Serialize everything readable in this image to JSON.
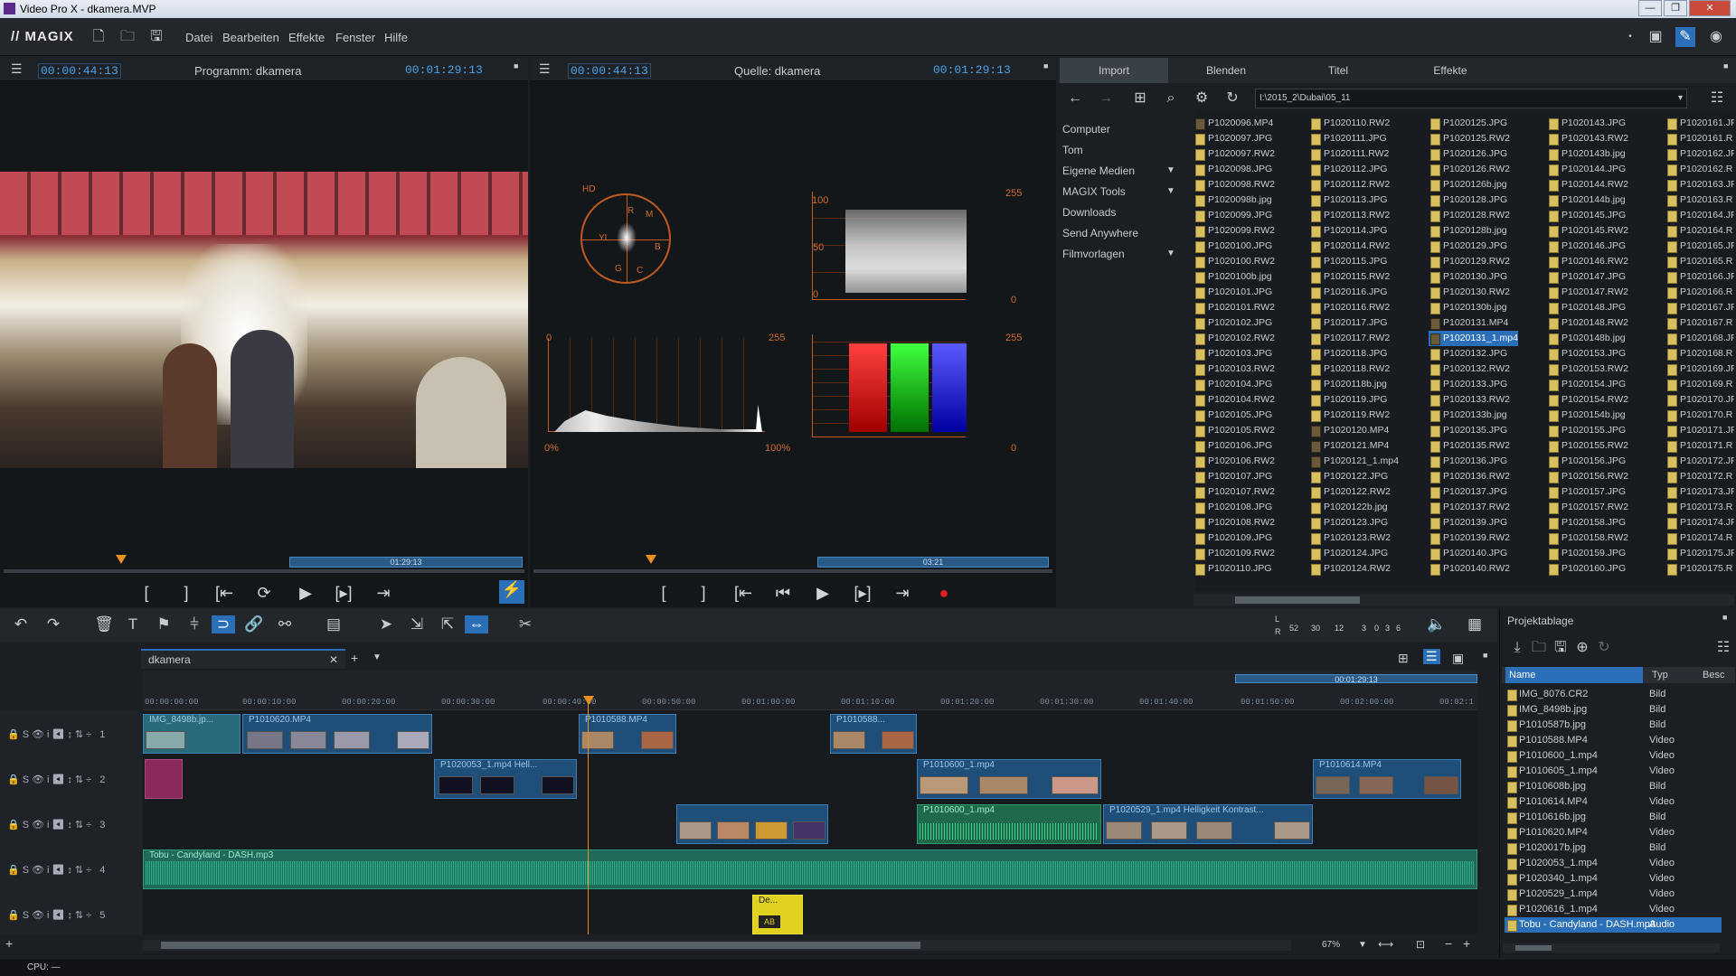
{
  "window": {
    "title": "Video Pro X - dkamera.MVP",
    "min": "—",
    "max": "❐",
    "close": "✕"
  },
  "menu": {
    "logo": "// MAGIX",
    "items": [
      "Datei",
      "Bearbeiten",
      "Effekte",
      "Fenster",
      "Hilfe"
    ]
  },
  "program_monitor": {
    "timecode_left": "00:00:44:13",
    "title": "Programm: dkamera",
    "timecode_right": "00:01:29:13",
    "seek_label": "01:29:13"
  },
  "source_monitor": {
    "timecode_left": "00:00:44:13",
    "title": "Quelle: dkamera",
    "timecode_right": "00:01:29:13",
    "seek_label": "03:21"
  },
  "scopes": {
    "vector_hd": "HD",
    "vector_labels": [
      "R",
      "M",
      "B",
      "C",
      "G",
      "YL"
    ],
    "wave_labels": [
      "100",
      "50",
      "0",
      "255",
      "0"
    ],
    "hist_labels": [
      "0",
      "255",
      "0%",
      "100%"
    ],
    "rgb_labels": [
      "255",
      "0"
    ]
  },
  "import_panel": {
    "tabs": [
      "Import",
      "Blenden",
      "Titel",
      "Effekte"
    ],
    "path": "I:\\2015_2\\Dubai\\05_11",
    "nav": [
      "Computer",
      "Tom",
      "Eigene Medien",
      "MAGIX Tools",
      "Downloads",
      "Send Anywhere",
      "Filmvorlagen"
    ],
    "col1": [
      "P1020096.MP4",
      "P1020097.JPG",
      "P1020097.RW2",
      "P1020098.JPG",
      "P1020098.RW2",
      "P1020098b.jpg",
      "P1020099.JPG",
      "P1020099.RW2",
      "P1020100.JPG",
      "P1020100.RW2",
      "P1020100b.jpg",
      "P1020101.JPG",
      "P1020101.RW2",
      "P1020102.JPG",
      "P1020102.RW2",
      "P1020103.JPG",
      "P1020103.RW2",
      "P1020104.JPG",
      "P1020104.RW2",
      "P1020105.JPG",
      "P1020105.RW2",
      "P1020106.JPG",
      "P1020106.RW2",
      "P1020107.JPG",
      "P1020107.RW2",
      "P1020108.JPG",
      "P1020108.RW2",
      "P1020109.JPG",
      "P1020109.RW2",
      "P1020110.JPG"
    ],
    "col2": [
      "P1020110.RW2",
      "P1020111.JPG",
      "P1020111.RW2",
      "P1020112.JPG",
      "P1020112.RW2",
      "P1020113.JPG",
      "P1020113.RW2",
      "P1020114.JPG",
      "P1020114.RW2",
      "P1020115.JPG",
      "P1020115.RW2",
      "P1020116.JPG",
      "P1020116.RW2",
      "P1020117.JPG",
      "P1020117.RW2",
      "P1020118.JPG",
      "P1020118.RW2",
      "P1020118b.jpg",
      "P1020119.JPG",
      "P1020119.RW2",
      "P1020120.MP4",
      "P1020121.MP4",
      "P1020121_1.mp4",
      "P1020122.JPG",
      "P1020122.RW2",
      "P1020122b.jpg",
      "P1020123.JPG",
      "P1020123.RW2",
      "P1020124.JPG",
      "P1020124.RW2"
    ],
    "col3": [
      "P1020125.JPG",
      "P1020125.RW2",
      "P1020126.JPG",
      "P1020126.RW2",
      "P1020126b.jpg",
      "P1020128.JPG",
      "P1020128.RW2",
      "P1020128b.jpg",
      "P1020129.JPG",
      "P1020129.RW2",
      "P1020130.JPG",
      "P1020130.RW2",
      "P1020130b.jpg",
      "P1020131.MP4",
      "P1020131_1.mp4",
      "P1020132.JPG",
      "P1020132.RW2",
      "P1020133.JPG",
      "P1020133.RW2",
      "P1020133b.jpg",
      "P1020135.JPG",
      "P1020135.RW2",
      "P1020136.JPG",
      "P1020136.RW2",
      "P1020137.JPG",
      "P1020137.RW2",
      "P1020139.JPG",
      "P1020139.RW2",
      "P1020140.JPG",
      "P1020140.RW2"
    ],
    "col4": [
      "P1020143.JPG",
      "P1020143.RW2",
      "P1020143b.jpg",
      "P1020144.JPG",
      "P1020144.RW2",
      "P1020144b.jpg",
      "P1020145.JPG",
      "P1020145.RW2",
      "P1020146.JPG",
      "P1020146.RW2",
      "P1020147.JPG",
      "P1020147.RW2",
      "P1020148.JPG",
      "P1020148.RW2",
      "P1020148b.jpg",
      "P1020153.JPG",
      "P1020153.RW2",
      "P1020154.JPG",
      "P1020154.RW2",
      "P1020154b.jpg",
      "P1020155.JPG",
      "P1020155.RW2",
      "P1020156.JPG",
      "P1020156.RW2",
      "P1020157.JPG",
      "P1020157.RW2",
      "P1020158.JPG",
      "P1020158.RW2",
      "P1020159.JPG",
      "P1020160.JPG"
    ],
    "col5": [
      "P1020161.JP",
      "P1020161.R",
      "P1020162.JP",
      "P1020162.R",
      "P1020163.JP",
      "P1020163.R",
      "P1020164.JP",
      "P1020164.R",
      "P1020165.JP",
      "P1020165.R",
      "P1020166.JP",
      "P1020166.R",
      "P1020167.JP",
      "P1020167.R",
      "P1020168.JP",
      "P1020168.R",
      "P1020169.JP",
      "P1020169.R",
      "P1020170.JP",
      "P1020170.R",
      "P1020171.JP",
      "P1020171.R",
      "P1020172.JP",
      "P1020172.R",
      "P1020173.JP",
      "P1020173.R",
      "P1020174.JP",
      "P1020174.R",
      "P1020175.JP",
      "P1020175.R"
    ]
  },
  "timeline": {
    "tab": "dkamera",
    "ruler": [
      "00:00:00:00",
      "00:00:10:00",
      "00:00:20:00",
      "00:00:30:00",
      "00:00:40:00",
      "00:00:50:00",
      "00:01:00:00",
      "00:01:10:00",
      "00:01:20:00",
      "00:01:30:00",
      "00:01:40:00",
      "00:01:50:00",
      "00:02:00:00",
      "00:02:1"
    ],
    "end_marker": "00:01:29:13",
    "tracks": [
      "1",
      "2",
      "3",
      "4",
      "5"
    ],
    "zoom": "67%",
    "meter": [
      "52",
      "30",
      "12",
      "3",
      "0",
      "3",
      "6"
    ],
    "meter_lr": [
      "L",
      "R"
    ],
    "clips": {
      "c1": "IMG_8498b.jp...",
      "c2": "P1010620.MP4",
      "c3": "P1010588.MP4",
      "c4": "P1010588...",
      "c5": "P1020053_1.mp4   Hell...",
      "c6": "P1010600_1.mp4",
      "c7": "P1010614.MP4",
      "c8": "P1010600_1.mp4",
      "c9": "P1020529_1.mp4   Helligkeit  Kontrast...",
      "c10": "Tobu - Candyland - DASH.mp3",
      "c11": "De..."
    }
  },
  "project": {
    "title": "Projektablage",
    "cols": [
      "Name",
      "Typ",
      "Besc"
    ],
    "rows": [
      [
        "IMG_8076.CR2",
        "Bild"
      ],
      [
        "IMG_8498b.jpg",
        "Bild"
      ],
      [
        "P1010587b.jpg",
        "Bild"
      ],
      [
        "P1010588.MP4",
        "Video"
      ],
      [
        "P1010600_1.mp4",
        "Video"
      ],
      [
        "P1010605_1.mp4",
        "Video"
      ],
      [
        "P1010608b.jpg",
        "Bild"
      ],
      [
        "P1010614.MP4",
        "Video"
      ],
      [
        "P1010616b.jpg",
        "Bild"
      ],
      [
        "P1010620.MP4",
        "Video"
      ],
      [
        "P1020017b.jpg",
        "Bild"
      ],
      [
        "P1020053_1.mp4",
        "Video"
      ],
      [
        "P1020340_1.mp4",
        "Video"
      ],
      [
        "P1020529_1.mp4",
        "Video"
      ],
      [
        "P1020616_1.mp4",
        "Video"
      ],
      [
        "Tobu - Candyland - DASH.mp3",
        "Audio"
      ]
    ]
  },
  "status": {
    "cpu": "CPU: —"
  },
  "colors": {
    "accent": "#2a6fb8",
    "timecode": "#4aa3e8",
    "record": "#e02020",
    "audio": "#1f8a6a"
  }
}
